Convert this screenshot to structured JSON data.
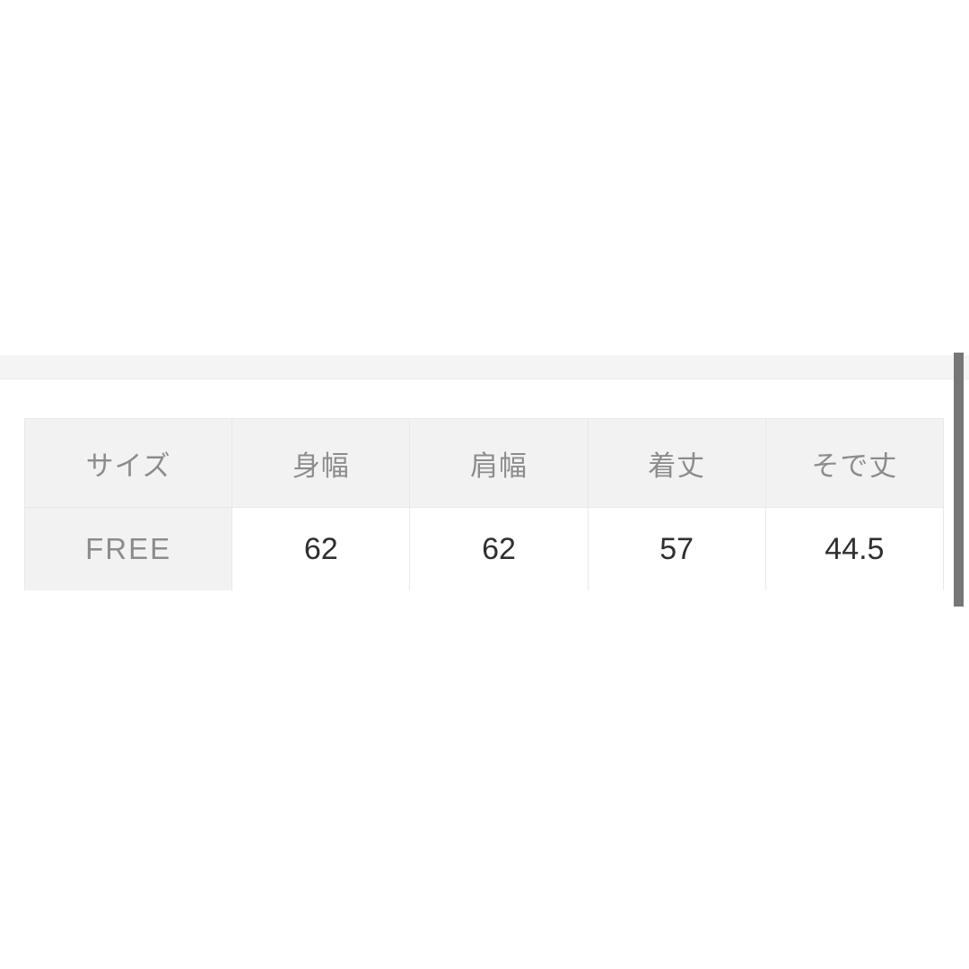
{
  "page": {
    "background_color": "#ffffff",
    "section_band_color": "#f4f4f4"
  },
  "scrollbar": {
    "name": "vertical-scrollbar",
    "thumb_color": "#767676",
    "orientation": "vertical"
  },
  "size_table": {
    "caption": "",
    "header_background": "#f2f2f2",
    "header_text_color": "#8c8c8c",
    "value_text_color": "#2f2f2f",
    "columns": [
      {
        "key": "size",
        "label": "サイズ"
      },
      {
        "key": "bust",
        "label": "身幅"
      },
      {
        "key": "shoulder",
        "label": "肩幅"
      },
      {
        "key": "length",
        "label": "着丈"
      },
      {
        "key": "sleeve",
        "label": "そで丈"
      }
    ],
    "rows": [
      {
        "size": "FREE",
        "bust": "62",
        "shoulder": "62",
        "length": "57",
        "sleeve": "44.5"
      }
    ]
  }
}
